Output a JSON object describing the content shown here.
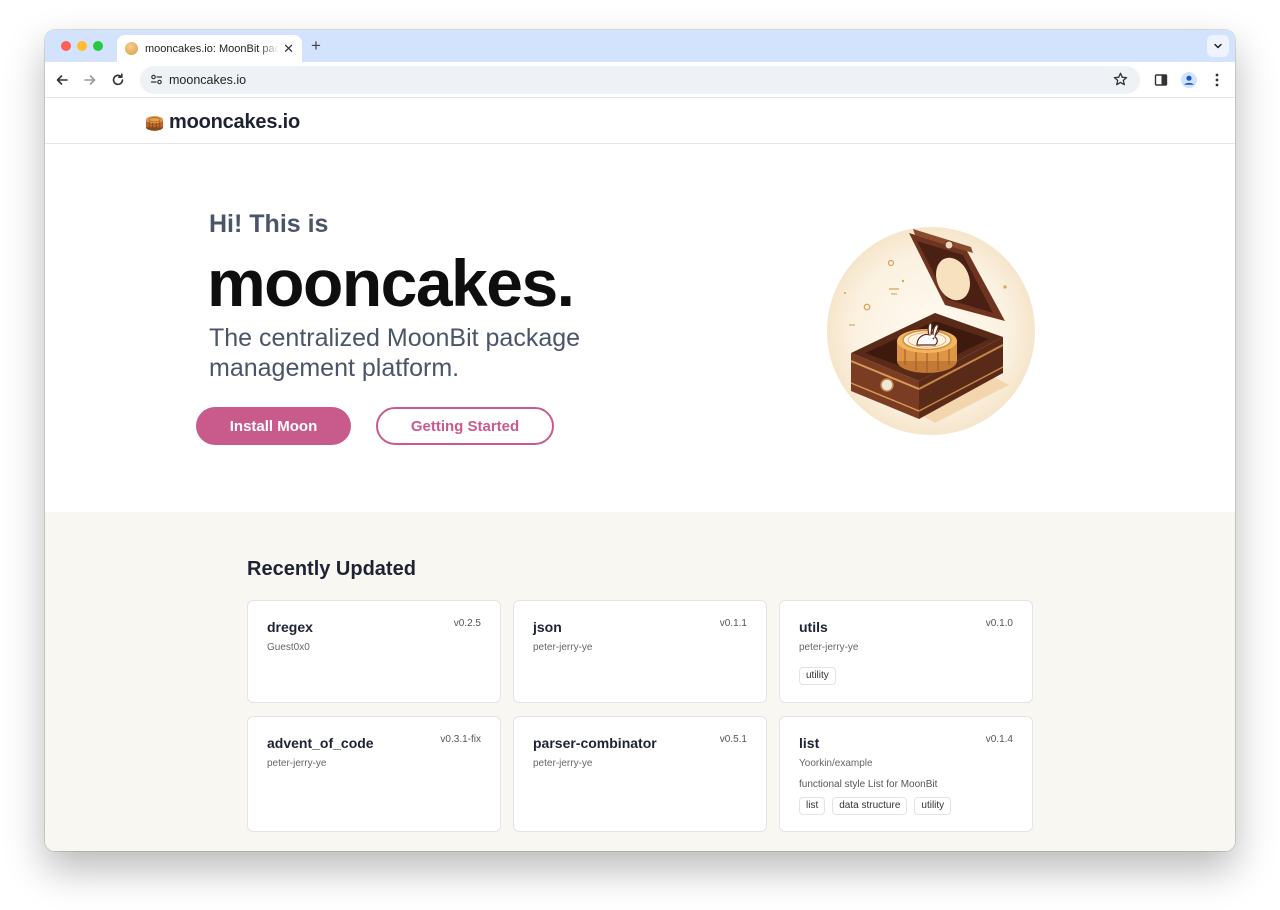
{
  "browser": {
    "tab_title": "mooncakes.io: MoonBit package",
    "tab_close": "✕",
    "new_tab": "+",
    "url": "mooncakes.io"
  },
  "site": {
    "logo_text": "mooncakes.io"
  },
  "hero": {
    "pre_title": "Hi! This is",
    "title": "mooncakes.",
    "subtitle": "The centralized MoonBit package management platform.",
    "primary_button": "Install Moon",
    "secondary_button": "Getting Started"
  },
  "recent": {
    "title": "Recently Updated",
    "cards": [
      {
        "name": "dregex",
        "version": "v0.2.5",
        "author": "Guest0x0",
        "description": "",
        "tags": []
      },
      {
        "name": "json",
        "version": "v0.1.1",
        "author": "peter-jerry-ye",
        "description": "",
        "tags": []
      },
      {
        "name": "utils",
        "version": "v0.1.0",
        "author": "peter-jerry-ye",
        "description": "",
        "tags": [
          "utility"
        ]
      },
      {
        "name": "advent_of_code",
        "version": "v0.3.1-fix",
        "author": "peter-jerry-ye",
        "description": "",
        "tags": []
      },
      {
        "name": "parser-combinator",
        "version": "v0.5.1",
        "author": "peter-jerry-ye",
        "description": "",
        "tags": []
      },
      {
        "name": "list",
        "version": "v0.1.4",
        "author": "Yoorkin/example",
        "description": "functional style List for MoonBit",
        "tags": [
          "list",
          "data structure",
          "utility"
        ]
      }
    ]
  },
  "colors": {
    "brand_pink": "#c95b8c",
    "section_bg": "#f9f7f2",
    "tab_strip": "#d3e3fd"
  },
  "icons": [
    "back-arrow-icon",
    "forward-arrow-icon",
    "reload-icon",
    "site-settings-icon",
    "bookmark-star-icon",
    "side-panel-icon",
    "profile-icon",
    "more-menu-icon",
    "mooncake-logo-icon"
  ]
}
